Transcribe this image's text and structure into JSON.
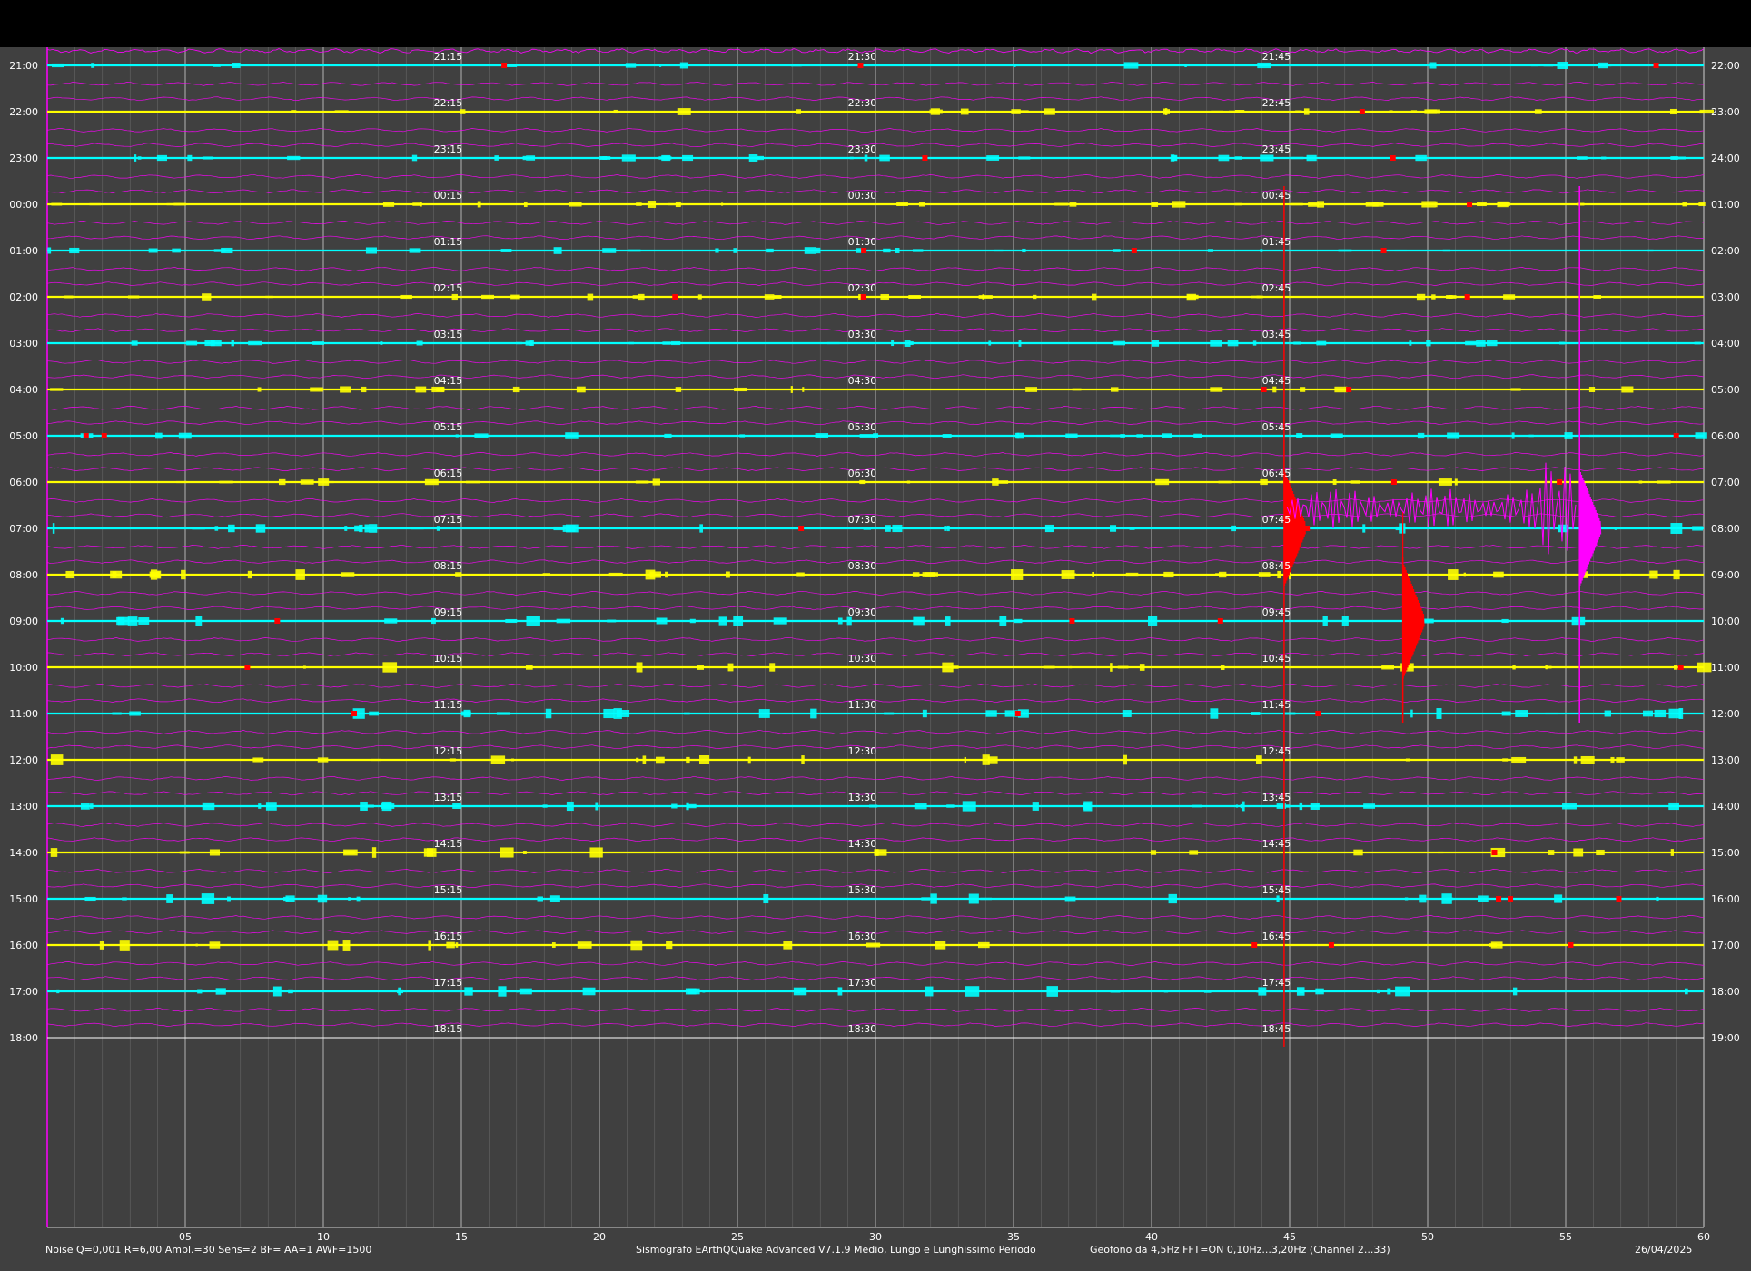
{
  "chart_data": {
    "type": "line",
    "title": "",
    "x_axis": {
      "range": [
        0,
        60
      ],
      "unit": "minutes",
      "tick_labels": [
        "05",
        "10",
        "15",
        "20",
        "25",
        "30",
        "35",
        "40",
        "45",
        "50",
        "55",
        "60"
      ]
    },
    "rows_left_labels": [
      "21:00",
      "22:00",
      "23:00",
      "00:00",
      "01:00",
      "02:00",
      "03:00",
      "04:00",
      "05:00",
      "06:00",
      "07:00",
      "08:00",
      "09:00",
      "10:00",
      "11:00",
      "12:00",
      "13:00",
      "14:00",
      "15:00",
      "16:00",
      "17:00",
      "18:00"
    ],
    "rows_right_labels": [
      "22:00",
      "23:00",
      "24:00",
      "01:00",
      "02:00",
      "03:00",
      "04:00",
      "05:00",
      "06:00",
      "07:00",
      "08:00",
      "09:00",
      "10:00",
      "11:00",
      "12:00",
      "13:00",
      "14:00",
      "15:00",
      "16:00",
      "17:00",
      "18:00",
      "19:00"
    ],
    "quarter_labels": [
      [
        "21:15",
        "21:30",
        "21:45"
      ],
      [
        "22:15",
        "22:30",
        "22:45"
      ],
      [
        "23:15",
        "23:30",
        "23:45"
      ],
      [
        "00:15",
        "00:30",
        "00:45"
      ],
      [
        "01:15",
        "01:30",
        "01:45"
      ],
      [
        "02:15",
        "02:30",
        "02:45"
      ],
      [
        "03:15",
        "03:30",
        "03:45"
      ],
      [
        "04:15",
        "04:30",
        "04:45"
      ],
      [
        "05:15",
        "05:30",
        "05:45"
      ],
      [
        "06:15",
        "06:30",
        "06:45"
      ],
      [
        "07:15",
        "07:30",
        "07:45"
      ],
      [
        "08:15",
        "08:30",
        "08:45"
      ],
      [
        "09:15",
        "09:30",
        "09:45"
      ],
      [
        "10:15",
        "10:30",
        "10:45"
      ],
      [
        "11:15",
        "11:30",
        "11:45"
      ],
      [
        "12:15",
        "12:30",
        "12:45"
      ],
      [
        "13:15",
        "13:30",
        "13:45"
      ],
      [
        "14:15",
        "14:30",
        "14:45"
      ],
      [
        "15:15",
        "15:30",
        "15:45"
      ],
      [
        "16:15",
        "16:30",
        "16:45"
      ],
      [
        "17:15",
        "17:30",
        "17:45"
      ],
      [
        "18:15",
        "18:30",
        "18:45"
      ]
    ],
    "series": [
      {
        "name": "",
        "color": "#00ffff",
        "rows": [
          0,
          2,
          4,
          6,
          8,
          10,
          12,
          14,
          16,
          18,
          20
        ]
      },
      {
        "name": "",
        "color": "#ffff00",
        "rows": [
          1,
          3,
          5,
          7,
          9,
          11,
          13,
          15,
          17,
          19
        ]
      },
      {
        "name": "",
        "color": "#ff00ff",
        "rows": "long-period traces between rows"
      }
    ],
    "events": [
      {
        "minute": 44.8,
        "row_start": 3,
        "row_end": 21,
        "color": "#ff0000",
        "peak_row": 10
      },
      {
        "minute": 55.5,
        "row_start": 3,
        "row_end": 14,
        "color": "#ff00ff",
        "peak_row": 10
      },
      {
        "minute": 49.1,
        "row_start": 11,
        "row_end": 14,
        "color": "#ff0000",
        "peak_row": 12
      }
    ],
    "grid": true,
    "background": "#404040",
    "colors": {
      "cyan": "#00ffff",
      "yellow": "#ffff00",
      "magenta": "#ff00ff",
      "red": "#ff0000",
      "grid": "#c8c8c8"
    }
  },
  "footer": {
    "left": "Noise Q=0,001 R=6,00 Ampl.=30 Sens=2 BF= AA=1 AWF=1500",
    "center": "Sismografo  EArthQQuake Advanced V7.1.9  Medio, Lungo e Lunghissimo Periodo",
    "right": "Geofono da 4,5Hz FFT=ON 0,10Hz...3,20Hz     (Channel 2...33)",
    "date": "26/04/2025"
  }
}
